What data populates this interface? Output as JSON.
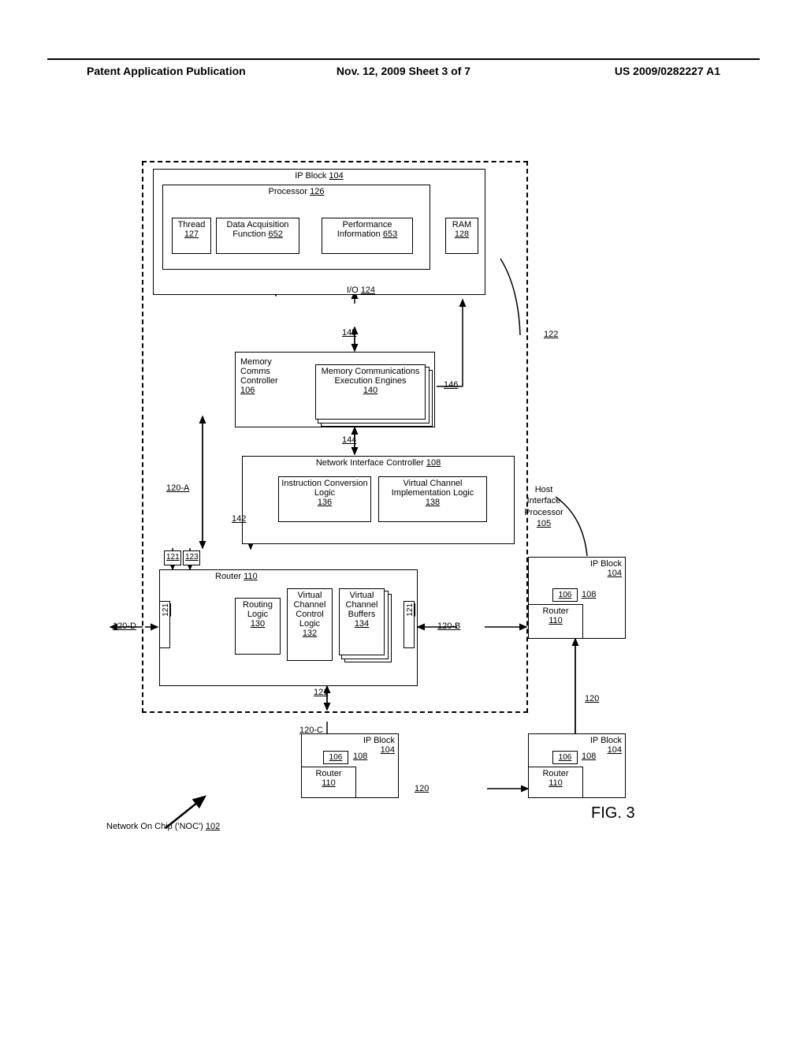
{
  "header": {
    "left": "Patent Application Publication",
    "center": "Nov. 12, 2009 Sheet 3 of 7",
    "right": "US 2009/0282227 A1"
  },
  "fig": "FIG. 3",
  "noc": {
    "label": "Network On Chip ('NOC')",
    "ref": "102"
  },
  "ipblock": {
    "title": "IP Block",
    "ref": "104"
  },
  "processor": {
    "title": "Processor",
    "ref": "126"
  },
  "thread": {
    "label": "Thread",
    "ref": "127"
  },
  "daf": {
    "label": "Data Acquisition Function",
    "ref": "652"
  },
  "perf": {
    "label": "Performance Information",
    "ref": "653"
  },
  "ram": {
    "label": "RAM",
    "ref": "128"
  },
  "io": {
    "label": "I/O",
    "ref": "124"
  },
  "ref145": "145",
  "mcc": {
    "label": "Memory Comms Controller",
    "ref": "106"
  },
  "mce": {
    "label": "Memory Communications Execution Engines",
    "ref": "140"
  },
  "ref146": "146",
  "ref144": "144",
  "nic": {
    "title": "Network Interface Controller",
    "ref": "108"
  },
  "icl": {
    "label": "Instruction Conversion Logic",
    "ref": "136"
  },
  "vcil": {
    "label": "Virtual Channel Implementation Logic",
    "ref": "138"
  },
  "ref142": "142",
  "ref120A": "120-A",
  "router": {
    "title": "Router",
    "ref": "110"
  },
  "rl": {
    "label": "Routing Logic",
    "ref": "130"
  },
  "vccl": {
    "label": "Virtual Channel Control Logic",
    "ref": "132"
  },
  "vcb": {
    "label": "Virtual Channel Buffers",
    "ref": "134"
  },
  "ref121": "121",
  "ref123": "123",
  "ref120B": "120-B",
  "ref120C": "120-C",
  "ref120D": "120-D",
  "hip": {
    "label": "Host Interface Processor",
    "ref": "105"
  },
  "ref122": "122",
  "sm": {
    "ip": "IP Block",
    "ipref": "104",
    "r106": "106",
    "r108": "108",
    "router": "Router",
    "routerref": "110"
  },
  "ref120": "120"
}
